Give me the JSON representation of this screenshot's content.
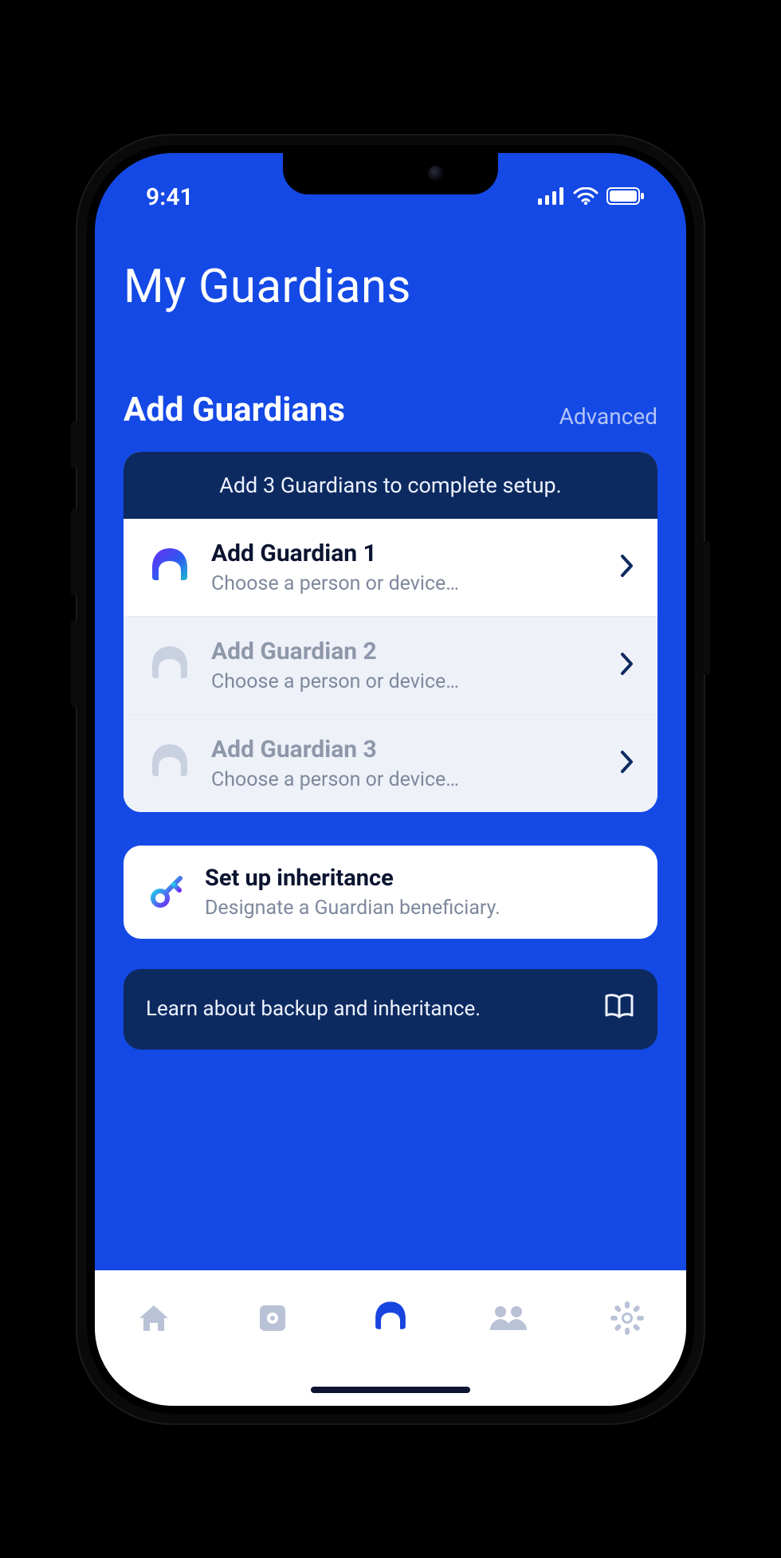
{
  "status": {
    "time": "9:41"
  },
  "page": {
    "title": "My Guardians"
  },
  "section": {
    "title": "Add Guardians",
    "advanced": "Advanced"
  },
  "banner": {
    "text": "Add 3 Guardians to complete setup."
  },
  "guardians": [
    {
      "title": "Add Guardian 1",
      "subtitle": "Choose a person or device…",
      "active": true
    },
    {
      "title": "Add Guardian 2",
      "subtitle": "Choose a person or device…",
      "active": false
    },
    {
      "title": "Add Guardian 3",
      "subtitle": "Choose a person or device…",
      "active": false
    }
  ],
  "inheritance": {
    "title": "Set up inheritance",
    "subtitle": "Designate a Guardian beneficiary."
  },
  "learn": {
    "text": "Learn about backup and inheritance."
  },
  "colors": {
    "primary": "#1449e5",
    "banner_bg": "#0d2a60",
    "muted": "#b9c2d6",
    "text_muted": "#7e889c"
  }
}
